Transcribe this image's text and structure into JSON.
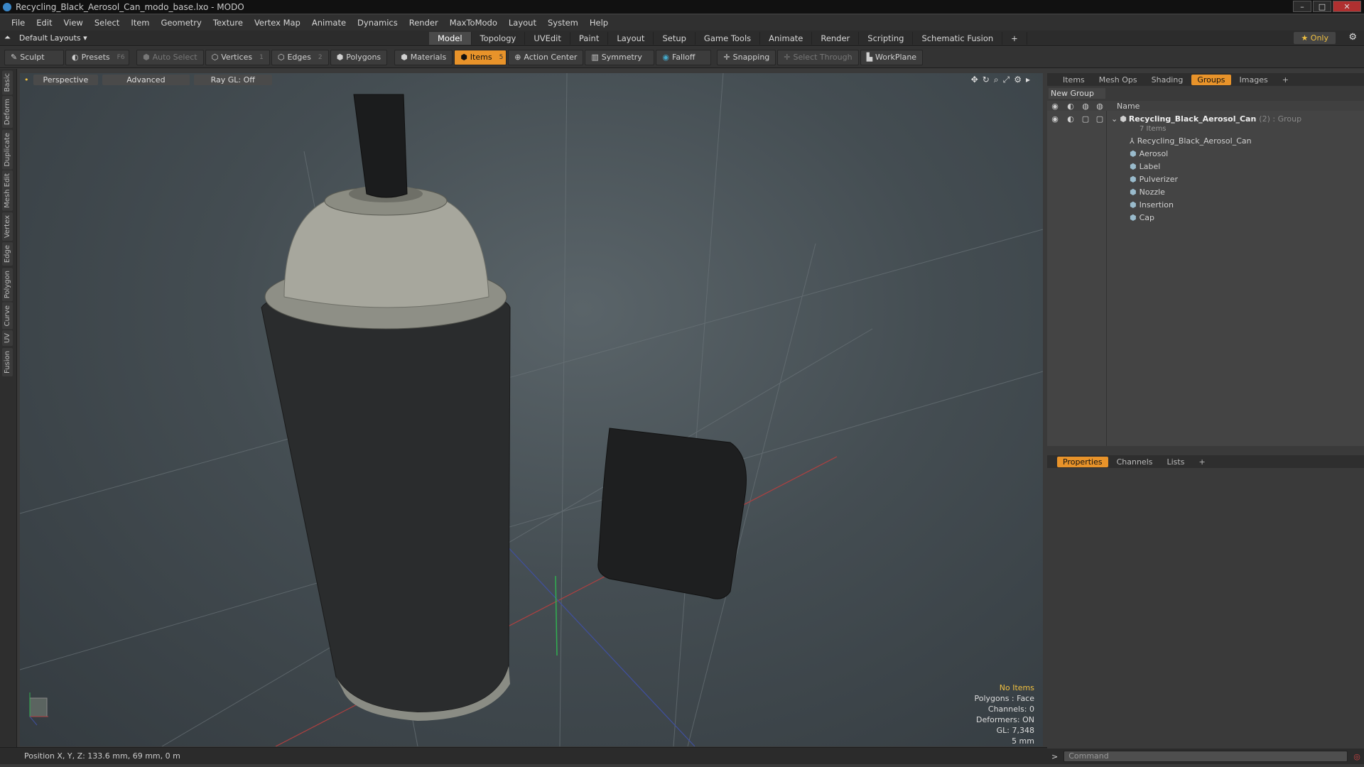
{
  "window": {
    "title": "Recycling_Black_Aerosol_Can_modo_base.lxo - MODO"
  },
  "menu": [
    "File",
    "Edit",
    "View",
    "Select",
    "Item",
    "Geometry",
    "Texture",
    "Vertex Map",
    "Animate",
    "Dynamics",
    "Render",
    "MaxToModo",
    "Layout",
    "System",
    "Help"
  ],
  "layout": {
    "selector": "Default Layouts",
    "tabs": [
      "Model",
      "Topology",
      "UVEdit",
      "Paint",
      "Layout",
      "Setup",
      "Game Tools",
      "Animate",
      "Render",
      "Scripting",
      "Schematic Fusion"
    ],
    "active_tab": "Model",
    "only_label": "Only"
  },
  "toolbar": {
    "sculpt": "Sculpt",
    "presets": "Presets",
    "presets_key": "F6",
    "auto_select": "Auto Select",
    "vertices": "Vertices",
    "vertices_count": "1",
    "edges": "Edges",
    "edges_count": "2",
    "polygons": "Polygons",
    "materials": "Materials",
    "items": "Items",
    "items_count": "5",
    "action_center": "Action Center",
    "symmetry": "Symmetry",
    "falloff": "Falloff",
    "snapping": "Snapping",
    "select_through": "Select Through",
    "workplane": "WorkPlane"
  },
  "left_tabs": [
    "Basic",
    "Deform",
    "Duplicate",
    "Mesh Edit",
    "Vertex",
    "Edge",
    "Polygon",
    "Curve",
    "UV",
    "Fusion"
  ],
  "viewport": {
    "view": "Perspective",
    "mode": "Advanced",
    "raygl": "Ray GL: Off",
    "info": {
      "selection": "No Items",
      "polygons": "Polygons : Face",
      "channels": "Channels: 0",
      "deformers": "Deformers: ON",
      "gl": "GL: 7,348",
      "unit": "5 mm"
    }
  },
  "status": {
    "position": "Position X, Y, Z:  133.6 mm, 69 mm, 0 m"
  },
  "groups_panel": {
    "tabs": [
      "Items",
      "Mesh Ops",
      "Shading",
      "Groups",
      "Images"
    ],
    "active_tab": "Groups",
    "new_group": "New Group",
    "column_name": "Name",
    "group": {
      "name": "Recycling_Black_Aerosol_Can",
      "suffix": "(2) : Group",
      "count": "7 Items"
    },
    "items": [
      "Recycling_Black_Aerosol_Can",
      "Aerosol",
      "Label",
      "Pulverizer",
      "Nozzle",
      "Insertion",
      "Cap"
    ]
  },
  "properties_panel": {
    "tabs": [
      "Properties",
      "Channels",
      "Lists"
    ],
    "active_tab": "Properties"
  },
  "command": {
    "placeholder": "Command"
  },
  "colors": {
    "accent": "#e8932a",
    "highlight": "#f0c040",
    "viewport_bg": "#444d52"
  }
}
